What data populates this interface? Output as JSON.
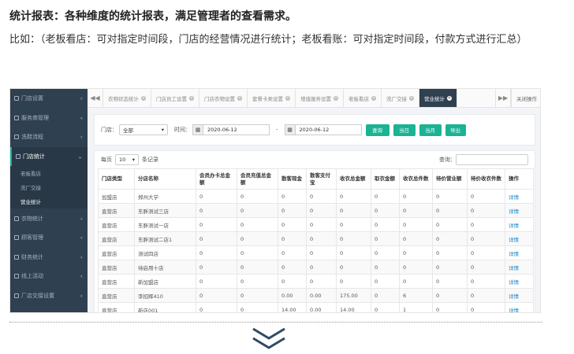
{
  "heading": "统计报表：各种维度的统计报表，满足管理者的查看需求。",
  "paragraph": "比如：（老板看店：可对指定时间段，门店的经营情况进行统计；老板看账：可对指定时间段，付款方式进行汇总）",
  "sidebar": {
    "items": [
      {
        "label": "门店设置"
      },
      {
        "label": "服务商管理"
      },
      {
        "label": "洗鞋流程"
      },
      {
        "label": "门店统计"
      },
      {
        "label": "衣物统计"
      },
      {
        "label": "顾客管理"
      },
      {
        "label": "财务统计"
      },
      {
        "label": "线上活动"
      },
      {
        "label": "厂店交接设置"
      },
      {
        "label": "工厂管理"
      }
    ],
    "sub_items": [
      {
        "label": "老板看店"
      },
      {
        "label": "洗厂交接"
      },
      {
        "label": "营业统计"
      }
    ]
  },
  "tabs": {
    "prev": "◀◀",
    "next": "▶▶",
    "items": [
      {
        "label": "衣物状态统计"
      },
      {
        "label": "门店员工设置"
      },
      {
        "label": "门店衣物设置"
      },
      {
        "label": "套餐卡类设置"
      },
      {
        "label": "增值服务设置"
      },
      {
        "label": "老板看店"
      },
      {
        "label": "洗厂交接"
      },
      {
        "label": "营业统计"
      }
    ],
    "close_ops": "关闭操作"
  },
  "filter": {
    "store_label": "门店：",
    "store_value": "全部",
    "time_label": "时间：",
    "date_from": "2020-06-12",
    "separator": "-",
    "date_to": "2020-06-12",
    "buttons": [
      "查询",
      "当日",
      "当月",
      "导出"
    ]
  },
  "table_controls": {
    "per_page_label": "每页",
    "per_page_value": "10",
    "records_label": "条记录",
    "search_label": "查询："
  },
  "table": {
    "headers": [
      "门店类型",
      "分店名称",
      "会员办卡总金额",
      "会员充值总金额",
      "散客现金",
      "散客支付宝",
      "收衣总金额",
      "取衣金额",
      "收衣总件数",
      "待价营业额",
      "待价收衣件数",
      "操作"
    ],
    "rows": [
      [
        "加盟店",
        "郑州大学",
        "0",
        "0",
        "0",
        "0",
        "0",
        "0",
        "0",
        "0",
        "0",
        "详情"
      ],
      [
        "直营店",
        "东胖测试三店",
        "0",
        "0",
        "0",
        "0",
        "0",
        "0",
        "0",
        "0",
        "0",
        "详情"
      ],
      [
        "直营店",
        "东胖测试一店",
        "0",
        "0",
        "0",
        "0",
        "0",
        "0",
        "0",
        "0",
        "0",
        "详情"
      ],
      [
        "直营店",
        "东胖测试二店1",
        "0",
        "0",
        "0",
        "0",
        "0",
        "0",
        "0",
        "0",
        "0",
        "详情"
      ],
      [
        "直营店",
        "测试四店",
        "0",
        "0",
        "0",
        "0",
        "0",
        "0",
        "0",
        "0",
        "0",
        "详情"
      ],
      [
        "直营店",
        "待启用十店",
        "0",
        "0",
        "0",
        "0",
        "0",
        "0",
        "0",
        "0",
        "0",
        "详情"
      ],
      [
        "直营店",
        "新加盟店",
        "0",
        "0",
        "0",
        "0",
        "0",
        "0",
        "0",
        "0",
        "0",
        "详情"
      ],
      [
        "直营店",
        "李招辉410",
        "0",
        "0",
        "0.00",
        "0.00",
        "175.00",
        "0",
        "6",
        "0",
        "0",
        "详情"
      ],
      [
        "直营店",
        "新店001",
        "0",
        "0",
        "14.00",
        "0.00",
        "14.00",
        "0",
        "1",
        "0",
        "0",
        "详情"
      ]
    ]
  }
}
